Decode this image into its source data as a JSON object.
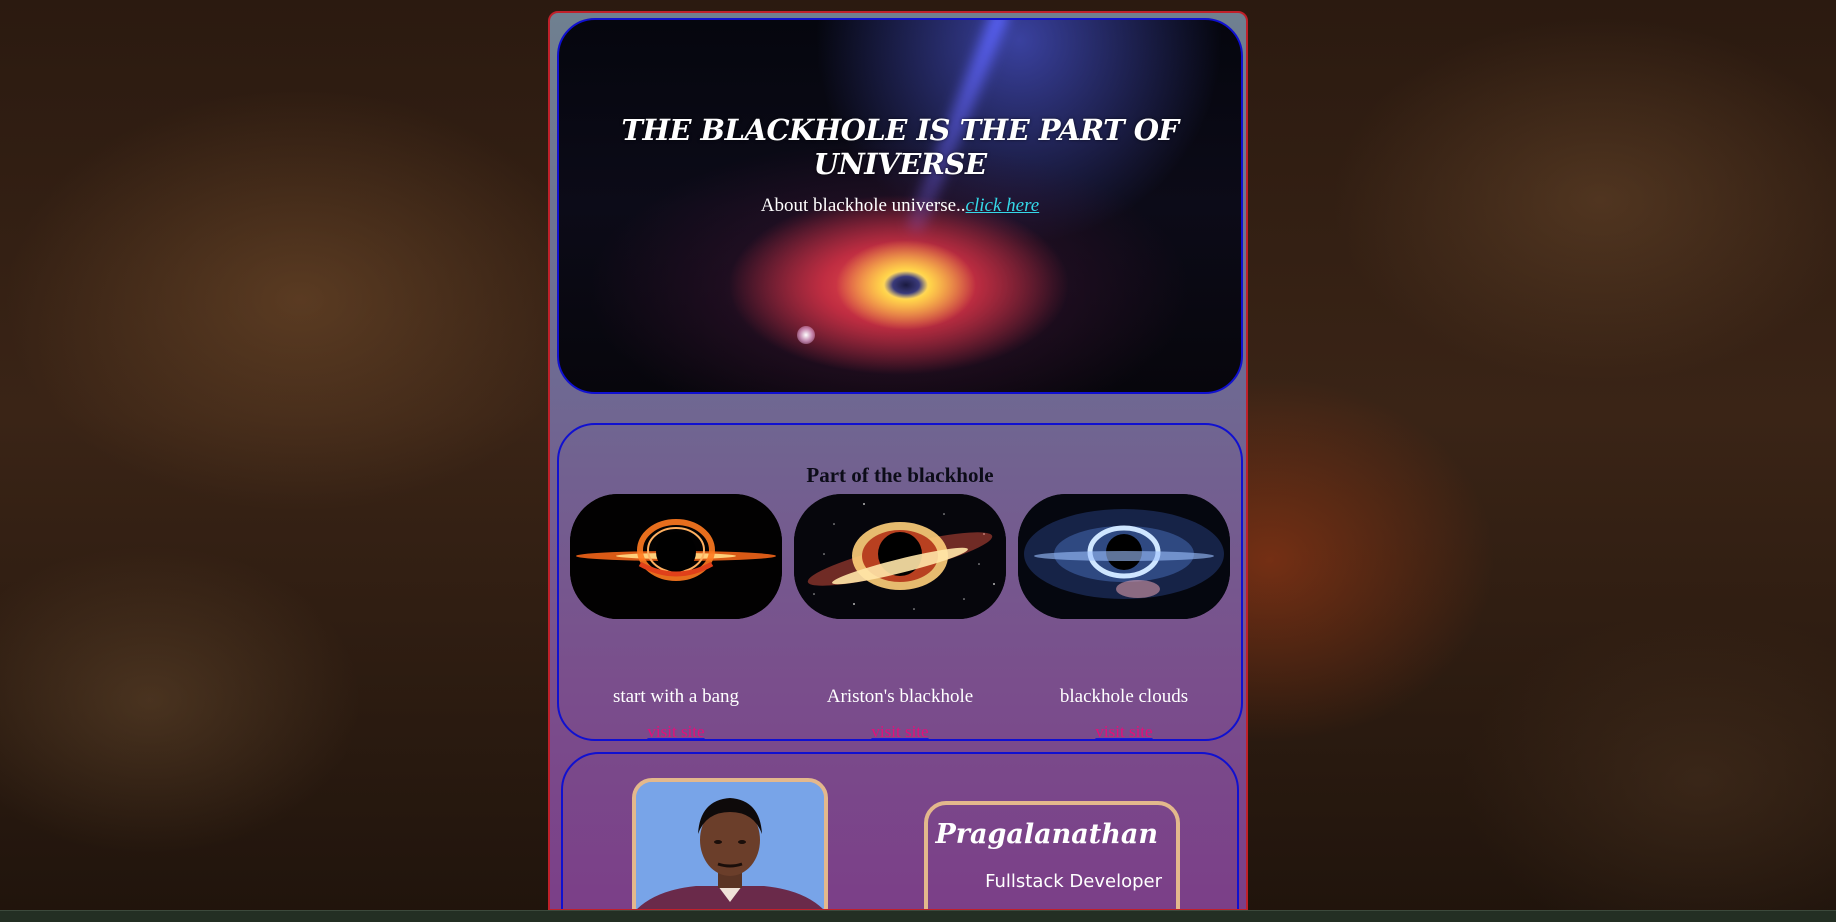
{
  "hero": {
    "title": "THE BLACKHOLE IS THE PART OF UNIVERSE",
    "about_text": "About blackhole universe..",
    "about_link": "click here"
  },
  "parts": {
    "heading": "Part of the blackhole",
    "cards": [
      {
        "label": "start with a bang",
        "link": "visit site",
        "image": "orange-accretion-disk-image"
      },
      {
        "label": "Ariston's blackhole",
        "link": "visit site",
        "image": "starfield-blackhole-image"
      },
      {
        "label": "blackhole clouds",
        "link": "visit site",
        "image": "blue-blackhole-image"
      }
    ]
  },
  "profile": {
    "name": "Pragalanathan",
    "role": "Fullstack Developer"
  },
  "colors": {
    "frame_border": "#c0202a",
    "section_border": "#1010d0",
    "link_color": "#e2107a",
    "hero_link_color": "#35d8e8",
    "photo_border": "#e3b88c"
  }
}
